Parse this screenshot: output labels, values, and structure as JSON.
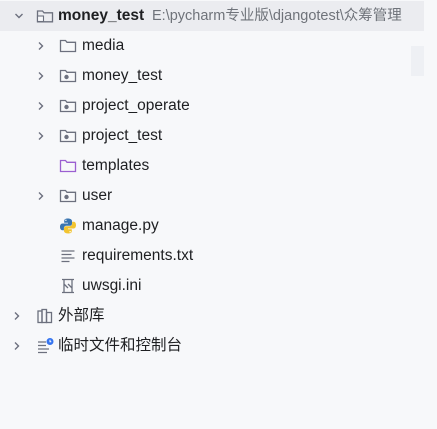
{
  "tree": {
    "root": {
      "name": "money_test",
      "path": "E:\\pycharm专业版\\djangotest\\众筹管理"
    },
    "items": [
      {
        "label": "media",
        "icon": "folder-icon",
        "expandable": true
      },
      {
        "label": "money_test",
        "icon": "package-folder-icon",
        "expandable": true
      },
      {
        "label": "project_operate",
        "icon": "package-folder-icon",
        "expandable": true
      },
      {
        "label": "project_test",
        "icon": "package-folder-icon",
        "expandable": true
      },
      {
        "label": "templates",
        "icon": "templates-folder-icon",
        "expandable": false
      },
      {
        "label": "user",
        "icon": "package-folder-icon",
        "expandable": true
      },
      {
        "label": "manage.py",
        "icon": "python-file-icon",
        "expandable": false
      },
      {
        "label": "requirements.txt",
        "icon": "text-file-icon",
        "expandable": false
      },
      {
        "label": "uwsgi.ini",
        "icon": "ini-file-icon",
        "expandable": false
      }
    ],
    "external_libraries": {
      "label": "外部库",
      "icon": "library-icon"
    },
    "scratches": {
      "label": "临时文件和控制台",
      "icon": "scratches-icon"
    }
  },
  "colors": {
    "background": "#f7f8fa",
    "selection": "#ebecf0",
    "templates_folder": "#9b5fd1",
    "python_blue": "#3a75b0",
    "python_yellow": "#f2c430",
    "icon_gray": "#6c707e"
  }
}
